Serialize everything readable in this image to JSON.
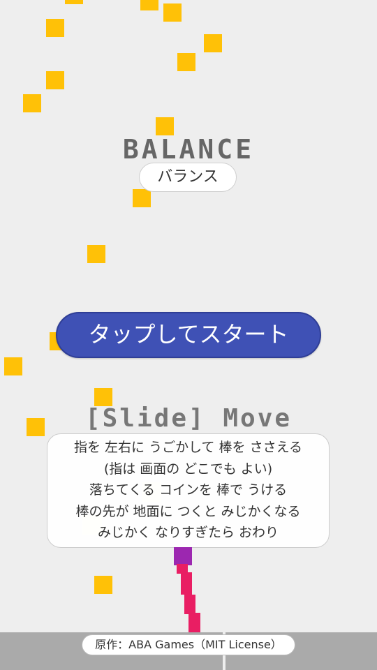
{
  "game": {
    "title": "BALANCE",
    "subtitle": "バランス",
    "start_label": "タップしてスタート",
    "control_hint": "[Slide] Move",
    "instructions": [
      "指を 左右に うごかして 棒を ささえる",
      "(指は 画面の どこでも よい)",
      "落ちてくる コインを 棒で うける",
      "棒の先が 地面に つくと みじかくなる",
      "みじかく なりすぎたら おわり"
    ],
    "credit": "原作：ABA Games（MIT License）"
  },
  "colors": {
    "background": "#eeeeee",
    "coin": "#ffc107",
    "button": "#3f51b5",
    "bar_tip": "#9c27b0",
    "bar": "#e91e63",
    "ground": "#aaaaaa"
  }
}
